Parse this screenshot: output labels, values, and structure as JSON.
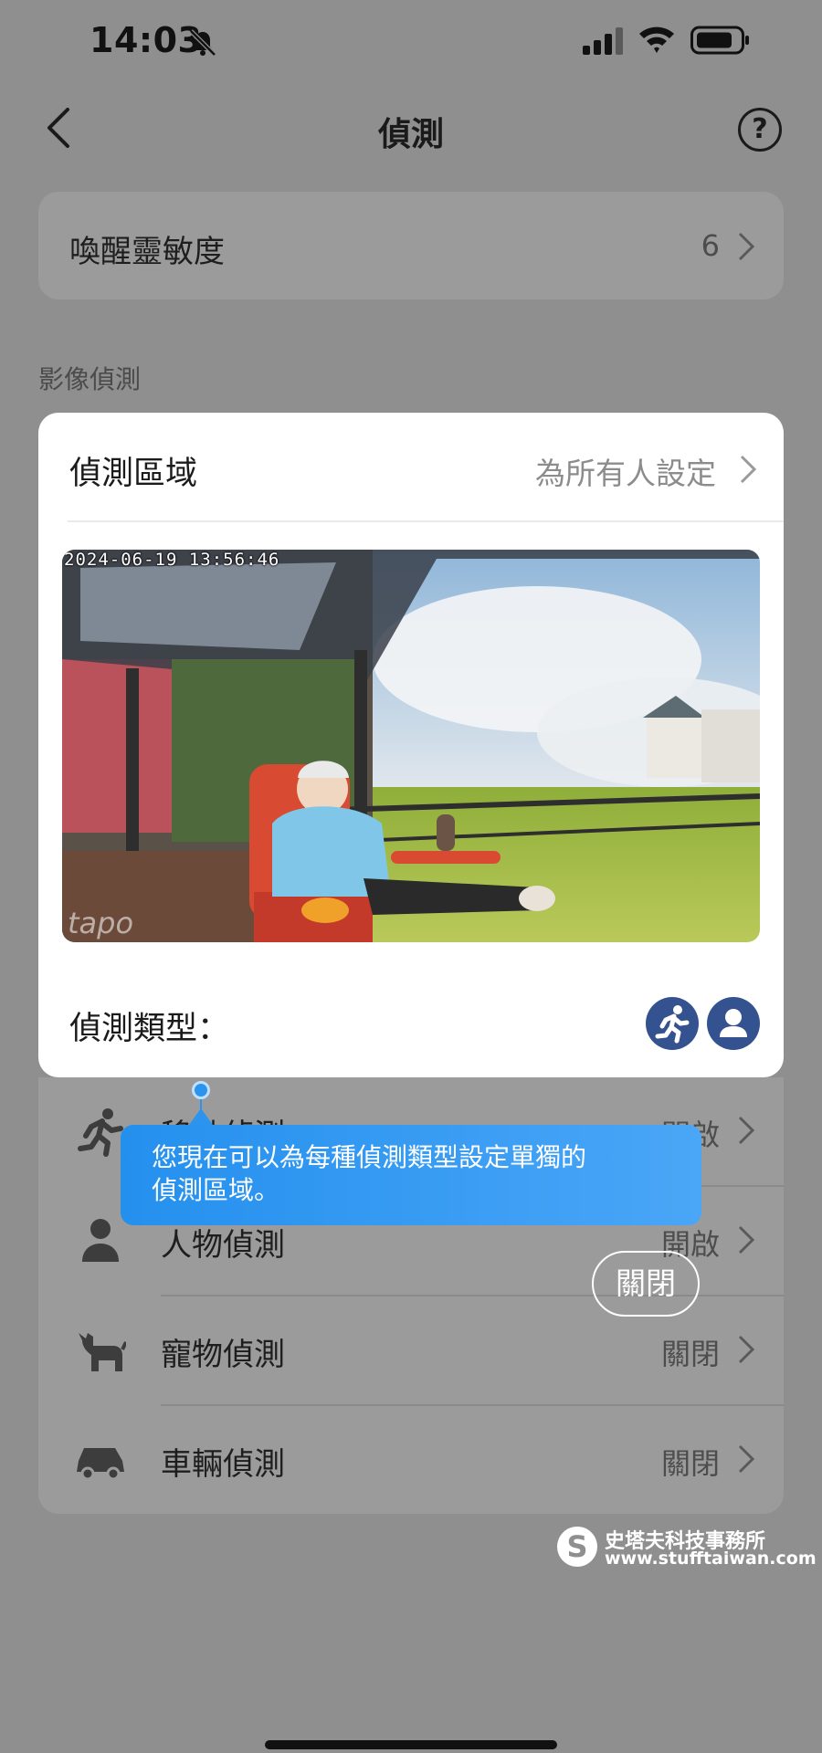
{
  "status_bar": {
    "time": "14:03"
  },
  "nav": {
    "title": "偵測"
  },
  "wake_sensitivity": {
    "label": "喚醒靈敏度",
    "value": "6"
  },
  "section_label": "影像偵測",
  "modal": {
    "title": "偵測區域",
    "value": "為所有人設定",
    "camera_timestamp": "2024-06-19 13:56:46",
    "camera_watermark": "tapo",
    "type_label": "偵測類型："
  },
  "detections": [
    {
      "label": "移動偵測",
      "value": "開啟",
      "icon": "running-person-icon"
    },
    {
      "label": "人物偵測",
      "value": "開啟",
      "icon": "person-icon"
    },
    {
      "label": "寵物偵測",
      "value": "關閉",
      "icon": "pet-icon"
    },
    {
      "label": "車輛偵測",
      "value": "關閉",
      "icon": "car-icon"
    }
  ],
  "tooltip": {
    "text_line1": "您現在可以為每種偵測類型設定單獨的",
    "text_line2": "偵測區域。",
    "close_label": "關閉"
  },
  "watermark": {
    "name": "史塔夫科技事務所",
    "url": "www.stufftaiwan.com",
    "logo": "S"
  },
  "colors": {
    "accent": "#2b94ef",
    "type_button": "#34528f",
    "overlay": "#8f8f8f"
  }
}
